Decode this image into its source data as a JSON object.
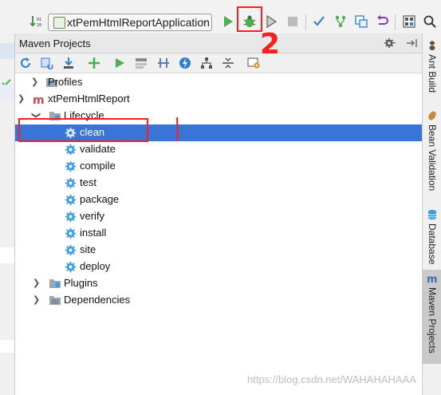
{
  "toolbar": {
    "run_configuration": "xtPemHtmlReportApplication",
    "icons": [
      "sort-icon",
      "run-icon",
      "debug-icon",
      "coverage-icon",
      "stop-icon",
      "vcs-update-icon",
      "vcs-commit-icon",
      "vcs-compare-icon",
      "vcs-revert-icon",
      "project-structure-icon",
      "search-icon"
    ]
  },
  "panel": {
    "title": "Maven Projects",
    "header_icons": [
      "settings-gear-icon",
      "pin-hide-icon"
    ],
    "toolbar_icons": [
      "reimport-icon",
      "generate-sources-icon",
      "download-icon",
      "add-icon",
      "run-maven-icon",
      "toggle-offline-icon",
      "skip-tests-icon",
      "lightning-icon",
      "dependency-diagram-icon",
      "collapse-all-icon",
      "maven-settings-icon"
    ]
  },
  "tree": {
    "profiles": "Profiles",
    "project": "xtPemHtmlReport",
    "lifecycle": "Lifecycle",
    "goals": [
      "clean",
      "validate",
      "compile",
      "test",
      "package",
      "verify",
      "install",
      "site",
      "deploy"
    ],
    "selected_goal": "clean",
    "plugins": "Plugins",
    "dependencies": "Dependencies"
  },
  "right_strip": {
    "tabs": [
      "Ant Build",
      "Bean Validation",
      "Database",
      "Maven Projects"
    ],
    "active_tab": "Maven Projects"
  },
  "annotation": {
    "number": "2"
  },
  "watermark": "https://blog.csdn.net/WAHAHAHAAA",
  "colors": {
    "selection": "#3875d7",
    "annotation": "#ff1e1e",
    "run_green": "#4caf50",
    "gear_blue": "#3d9be0"
  }
}
